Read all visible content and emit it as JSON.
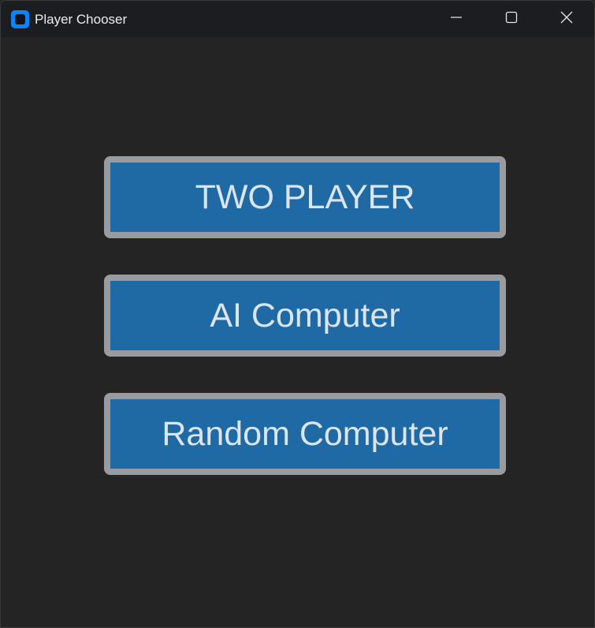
{
  "window": {
    "title": "Player Chooser",
    "app_icon": "app-icon",
    "controls": [
      "minimize-icon",
      "maximize-icon",
      "close-icon"
    ]
  },
  "buttons": [
    {
      "label": "TWO PLAYER"
    },
    {
      "label": "AI Computer"
    },
    {
      "label": "Random Computer"
    }
  ],
  "colors": {
    "background": "#242424",
    "titlebar": "#1b1d20",
    "button_fill": "#1f6aa5",
    "button_border": "#9a9b9e",
    "button_text": "#dce4ee",
    "app_icon": "#0a84ff"
  }
}
